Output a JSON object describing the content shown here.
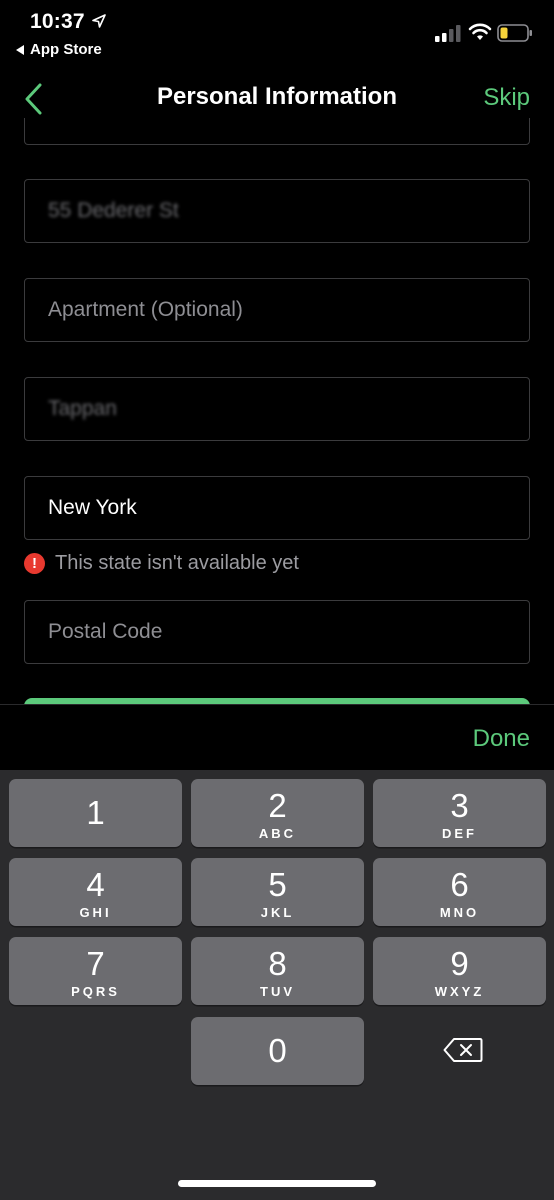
{
  "status_bar": {
    "time": "10:37",
    "back_app": "App Store"
  },
  "nav": {
    "title": "Personal Information",
    "skip_label": "Skip"
  },
  "form": {
    "address_value": "55 Dederer St",
    "apartment_placeholder": "Apartment (Optional)",
    "city_value": "Tappan",
    "state_value": "New York",
    "state_error": "This state isn't available yet",
    "postal_placeholder": "Postal Code"
  },
  "keyboard": {
    "done_label": "Done",
    "keys": [
      {
        "num": "1",
        "letters": ""
      },
      {
        "num": "2",
        "letters": "ABC"
      },
      {
        "num": "3",
        "letters": "DEF"
      },
      {
        "num": "4",
        "letters": "GHI"
      },
      {
        "num": "5",
        "letters": "JKL"
      },
      {
        "num": "6",
        "letters": "MNO"
      },
      {
        "num": "7",
        "letters": "PQRS"
      },
      {
        "num": "8",
        "letters": "TUV"
      },
      {
        "num": "9",
        "letters": "WXYZ"
      },
      {
        "num": "0",
        "letters": ""
      }
    ]
  },
  "colors": {
    "accent": "#5cc97b",
    "error": "#e8392f",
    "key": "#6c6c70",
    "keyboard_bg": "#2b2b2d"
  },
  "icons": {
    "nav_back": "chevron-left-icon",
    "error": "exclamation-circle-icon",
    "delete": "backspace-icon"
  }
}
